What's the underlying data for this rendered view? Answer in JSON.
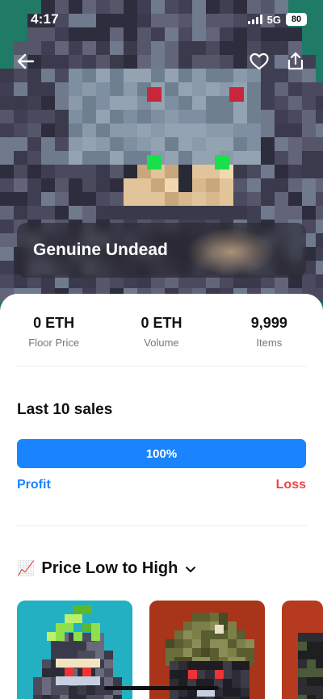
{
  "status_bar": {
    "time": "4:17",
    "network": "5G",
    "battery": "80"
  },
  "collection": {
    "name": "Genuine Undead"
  },
  "stats": [
    {
      "value": "0 ETH",
      "label": "Floor Price"
    },
    {
      "value": "0 ETH",
      "label": "Volume"
    },
    {
      "value": "9,999",
      "label": "Items"
    }
  ],
  "sales": {
    "title": "Last 10 sales",
    "profit_percent": 100,
    "percent_label": "100%",
    "profit_label": "Profit",
    "loss_label": "Loss"
  },
  "sort": {
    "emoji": "📈",
    "label": "Price Low to High",
    "icon": "chevron-down-icon"
  },
  "colors": {
    "accent_blue": "#1a84ff",
    "loss_red": "#ef4444",
    "hero_green": "#1f7a66",
    "eye_green": "#19e04a",
    "eye_red": "#c8263a"
  },
  "icons": [
    "back-arrow-icon",
    "heart-icon",
    "share-icon",
    "chart-up-emoji",
    "chevron-down-icon"
  ]
}
